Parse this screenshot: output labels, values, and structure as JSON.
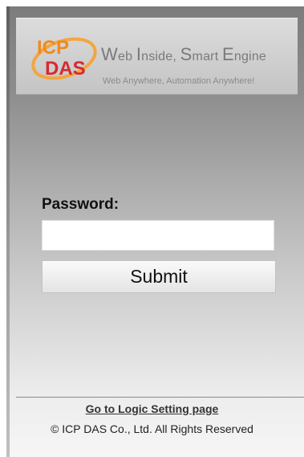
{
  "banner": {
    "logo_text_top": "ICP",
    "logo_text_bottom": "DAS",
    "tagline_parts": [
      {
        "initial": "W",
        "rest": "eb "
      },
      {
        "initial": "I",
        "rest": "nside, "
      },
      {
        "initial": "S",
        "rest": "mart "
      },
      {
        "initial": "E",
        "rest": "ngine"
      }
    ],
    "subtagline": "Web Anywhere, Automation Anywhere!",
    "logo_colors": {
      "orange": "#f08a1c",
      "red": "#d9282f"
    }
  },
  "login": {
    "password_label": "Password:",
    "password_value": "",
    "password_placeholder": "",
    "submit_label": "Submit"
  },
  "footer": {
    "logic_link": "Go to Logic Setting page",
    "copyright": "© ICP DAS Co., Ltd. All Rights Reserved"
  }
}
